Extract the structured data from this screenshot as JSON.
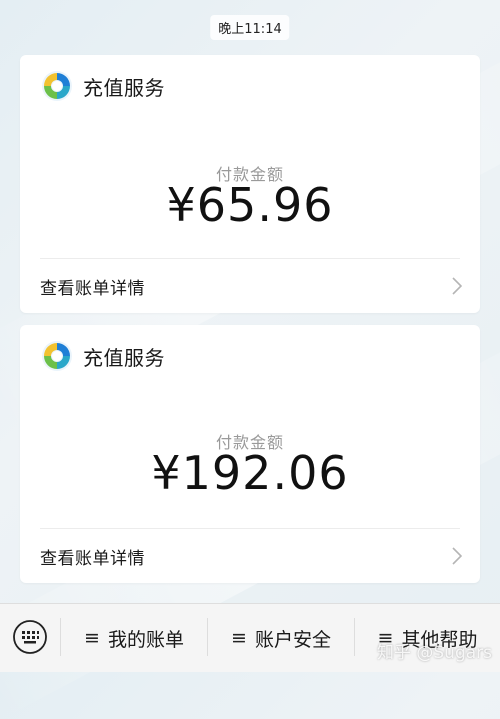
{
  "timestamp": "晚上11:14",
  "cards": [
    {
      "service_name": "充值服务",
      "logo_icon": "wechat-pay-service-logo",
      "amount_label": "付款金额",
      "amount": "¥65.96",
      "detail_label": "查看账单详情"
    },
    {
      "service_name": "充值服务",
      "logo_icon": "wechat-pay-service-logo",
      "amount_label": "付款金额",
      "amount": "¥192.06",
      "detail_label": "查看账单详情"
    }
  ],
  "bottom_menu": {
    "keyboard_icon": "keyboard-icon",
    "items": [
      {
        "icon": "≡",
        "label": "我的账单"
      },
      {
        "icon": "≡",
        "label": "账户安全"
      },
      {
        "icon": "≡",
        "label": "其他帮助"
      }
    ]
  },
  "watermark": "知乎 @Sugars",
  "colors": {
    "card_bg": "#ffffff",
    "page_bg": "#e9f1f5",
    "muted_text": "#9a9a9a",
    "logo_blue": "#1f7fd6",
    "logo_green": "#6cc04a"
  }
}
